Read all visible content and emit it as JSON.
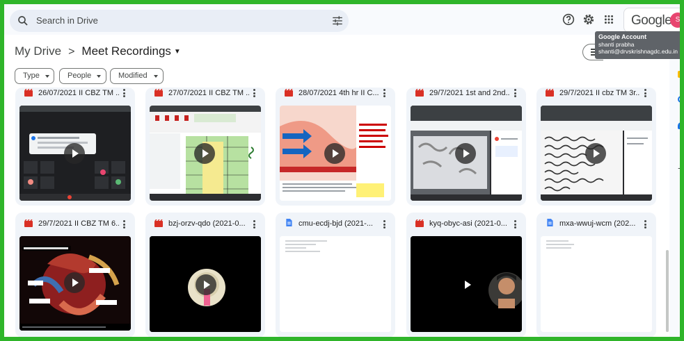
{
  "search": {
    "placeholder": "Search in Drive"
  },
  "header": {
    "google_label": "Google",
    "avatar_letter": "S"
  },
  "tooltip": {
    "title": "Google Account",
    "name": "shanti prabha",
    "email": "shanti@drvskrishnagdc.edu.in"
  },
  "breadcrumb": {
    "root": "My Drive",
    "separator": ">",
    "current": "Meet Recordings"
  },
  "filters": [
    "Type",
    "People",
    "Modified"
  ],
  "files": [
    {
      "title": "26/07/2021 II CBZ TM ...",
      "type": "video",
      "icon": "video-file-icon"
    },
    {
      "title": "27/07/2021 II CBZ TM ...",
      "type": "video",
      "icon": "video-file-icon"
    },
    {
      "title": "28/07/2021 4th hr II C...",
      "type": "video",
      "icon": "video-file-icon"
    },
    {
      "title": "29/7/2021 1st and 2nd...",
      "type": "video",
      "icon": "video-file-icon"
    },
    {
      "title": "29/7/2021 II cbz TM 3r...",
      "type": "video",
      "icon": "video-file-icon"
    },
    {
      "title": "29/7/2021 II CBZ TM 6...",
      "type": "video",
      "icon": "video-file-icon"
    },
    {
      "title": "bzj-orzv-qdo (2021-0...",
      "type": "video",
      "icon": "video-file-icon"
    },
    {
      "title": "cmu-ecdj-bjd (2021-...",
      "type": "doc",
      "icon": "doc-file-icon"
    },
    {
      "title": "kyq-obyc-asi (2021-0...",
      "type": "video",
      "icon": "video-file-icon"
    },
    {
      "title": "mxa-wwuj-wcm (202...",
      "type": "doc",
      "icon": "doc-file-icon"
    }
  ],
  "colors": {
    "frame": "#2fb52a",
    "video_icon": "#d93025",
    "doc_icon": "#4285f4",
    "avatar": "#e8456f",
    "card_bg": "#f0f4f9"
  }
}
